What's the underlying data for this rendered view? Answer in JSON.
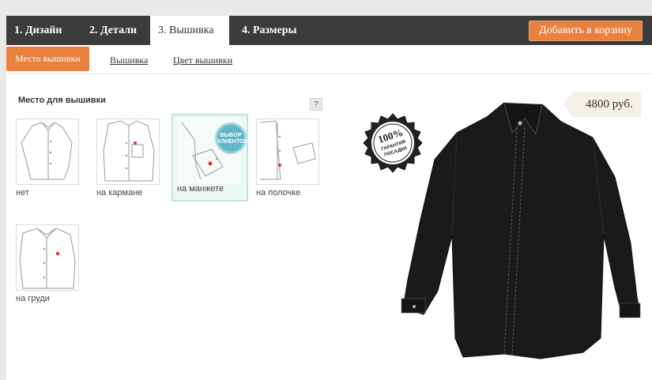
{
  "nav": {
    "tabs": [
      {
        "label": "1. Дизайн"
      },
      {
        "label": "2. Детали"
      },
      {
        "label": "3. Вышивка"
      },
      {
        "label": "4. Размеры"
      }
    ],
    "cart_button": "Добавить в корзину"
  },
  "subnav": {
    "tabs": [
      {
        "label": "Место вышивки"
      },
      {
        "label": "Вышивка"
      },
      {
        "label": "Цвет вышивки"
      }
    ]
  },
  "section": {
    "title": "Место для вышивки",
    "help": "?"
  },
  "options": [
    {
      "label": "нет"
    },
    {
      "label": "на кармане"
    },
    {
      "label": "на манжете",
      "badge": "ВЫБОР КЛИЕНТОВ"
    },
    {
      "label": "на полочке"
    },
    {
      "label": "на груди"
    }
  ],
  "product": {
    "price": "4800 руб.",
    "seal_lines": [
      "100%",
      "ГАРАНТИЯ",
      "ПОСАДКИ"
    ]
  },
  "colors": {
    "accent": "#e8803f",
    "nav_bg": "#3b3b3b",
    "selected_border": "#bfe3de",
    "shirt": "#1a1a1a"
  }
}
